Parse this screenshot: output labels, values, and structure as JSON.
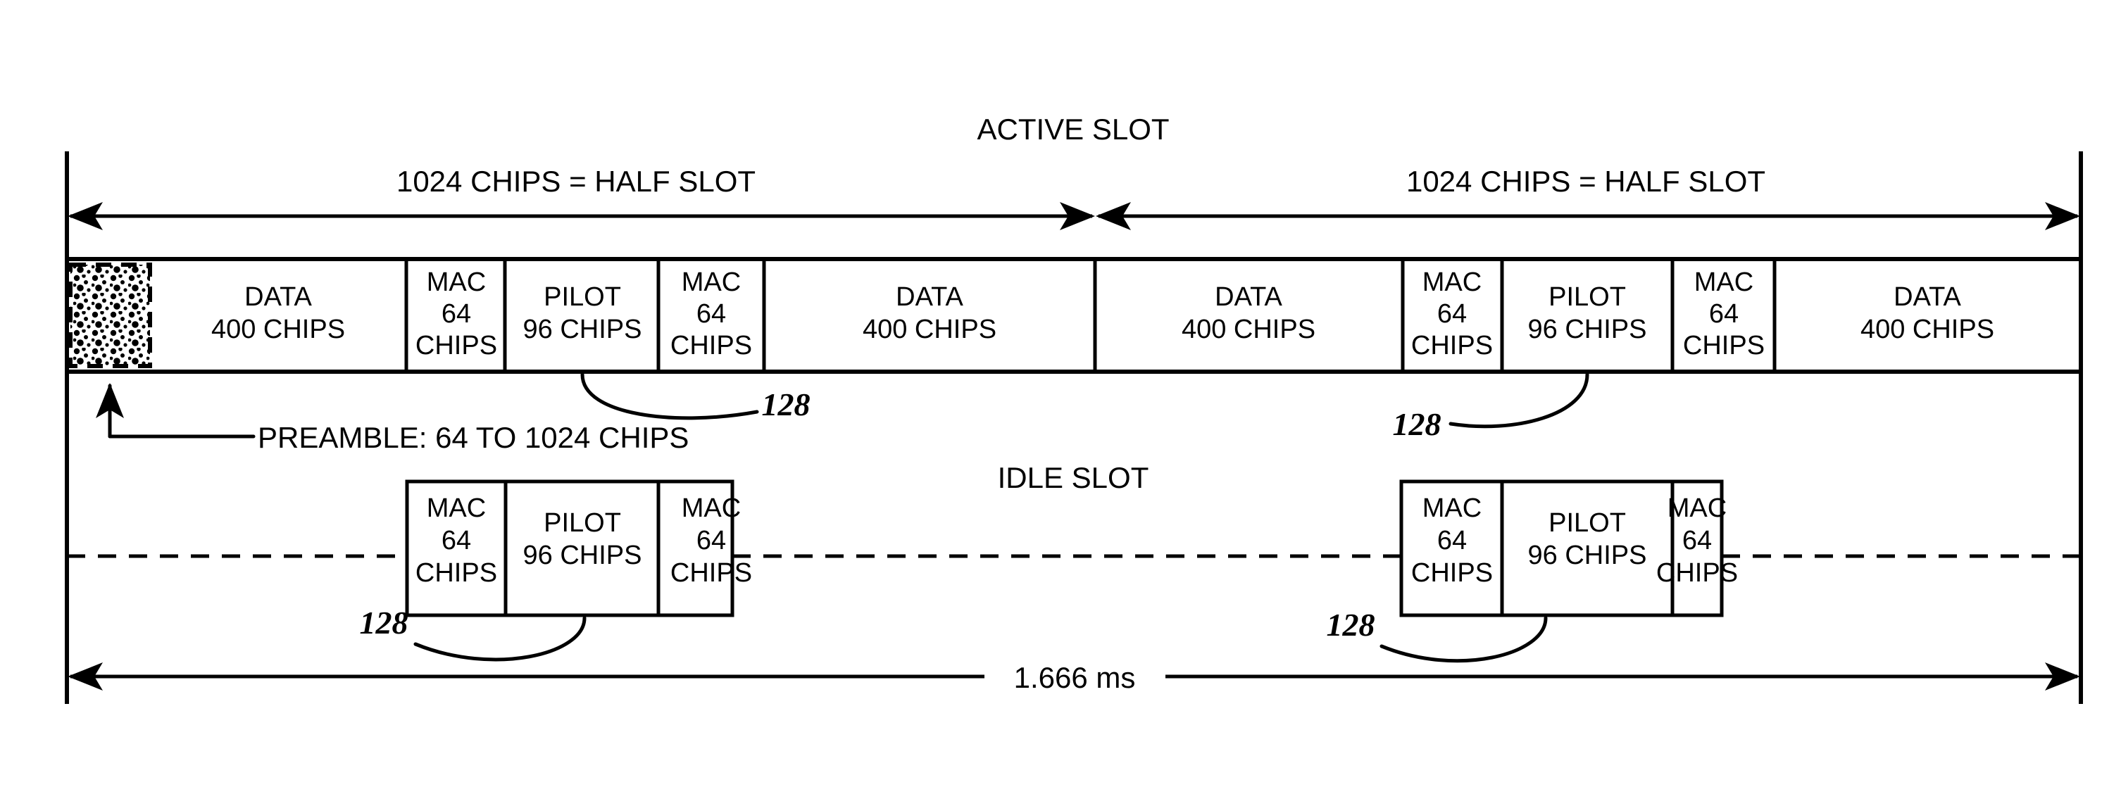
{
  "figure": {
    "reference_numeral": "128",
    "total_duration_label": "1.666 ms"
  },
  "titles": {
    "active_slot": "ACTIVE SLOT",
    "idle_slot": "IDLE SLOT"
  },
  "half_slot_dimensions": [
    {
      "label": "1024 CHIPS = HALF SLOT"
    },
    {
      "label": "1024 CHIPS = HALF SLOT"
    }
  ],
  "preamble": {
    "callout": "PREAMBLE: 64 TO 1024 CHIPS",
    "min_chips": "64",
    "max_chips": "1024"
  },
  "active_slot": {
    "segments": [
      {
        "name": "preamble",
        "line1": "",
        "line2": "",
        "line3": ""
      },
      {
        "name": "data",
        "line1": "DATA",
        "line2": "400 CHIPS",
        "line3": ""
      },
      {
        "name": "mac",
        "line1": "MAC",
        "line2": "64",
        "line3": "CHIPS"
      },
      {
        "name": "pilot",
        "line1": "PILOT",
        "line2": "96 CHIPS",
        "line3": ""
      },
      {
        "name": "mac",
        "line1": "MAC",
        "line2": "64",
        "line3": "CHIPS"
      },
      {
        "name": "data",
        "line1": "DATA",
        "line2": "400 CHIPS",
        "line3": ""
      },
      {
        "name": "data",
        "line1": "DATA",
        "line2": "400 CHIPS",
        "line3": ""
      },
      {
        "name": "mac",
        "line1": "MAC",
        "line2": "64",
        "line3": "CHIPS"
      },
      {
        "name": "pilot",
        "line1": "PILOT",
        "line2": "96 CHIPS",
        "line3": ""
      },
      {
        "name": "mac",
        "line1": "MAC",
        "line2": "64",
        "line3": "CHIPS"
      },
      {
        "name": "data",
        "line1": "DATA",
        "line2": "400 CHIPS",
        "line3": ""
      }
    ]
  },
  "idle_slot": {
    "left_group": [
      {
        "name": "mac",
        "line1": "MAC",
        "line2": "64",
        "line3": "CHIPS"
      },
      {
        "name": "pilot",
        "line1": "PILOT",
        "line2": "96 CHIPS",
        "line3": ""
      },
      {
        "name": "mac",
        "line1": "MAC",
        "line2": "64",
        "line3": "CHIPS"
      }
    ],
    "right_group": [
      {
        "name": "mac",
        "line1": "MAC",
        "line2": "64",
        "line3": "CHIPS"
      },
      {
        "name": "pilot",
        "line1": "PILOT",
        "line2": "96 CHIPS",
        "line3": ""
      },
      {
        "name": "mac",
        "line1": "MAC",
        "line2": "64",
        "line3": "CHIPS"
      }
    ]
  },
  "ref_labels": [
    {
      "text": "128",
      "target": "active-left-pilot"
    },
    {
      "text": "128",
      "target": "active-right-pilot"
    },
    {
      "text": "128",
      "target": "idle-left-pilot"
    },
    {
      "text": "128",
      "target": "idle-right-pilot"
    }
  ],
  "colors": {
    "ink": "#000000",
    "paper": "#ffffff"
  }
}
